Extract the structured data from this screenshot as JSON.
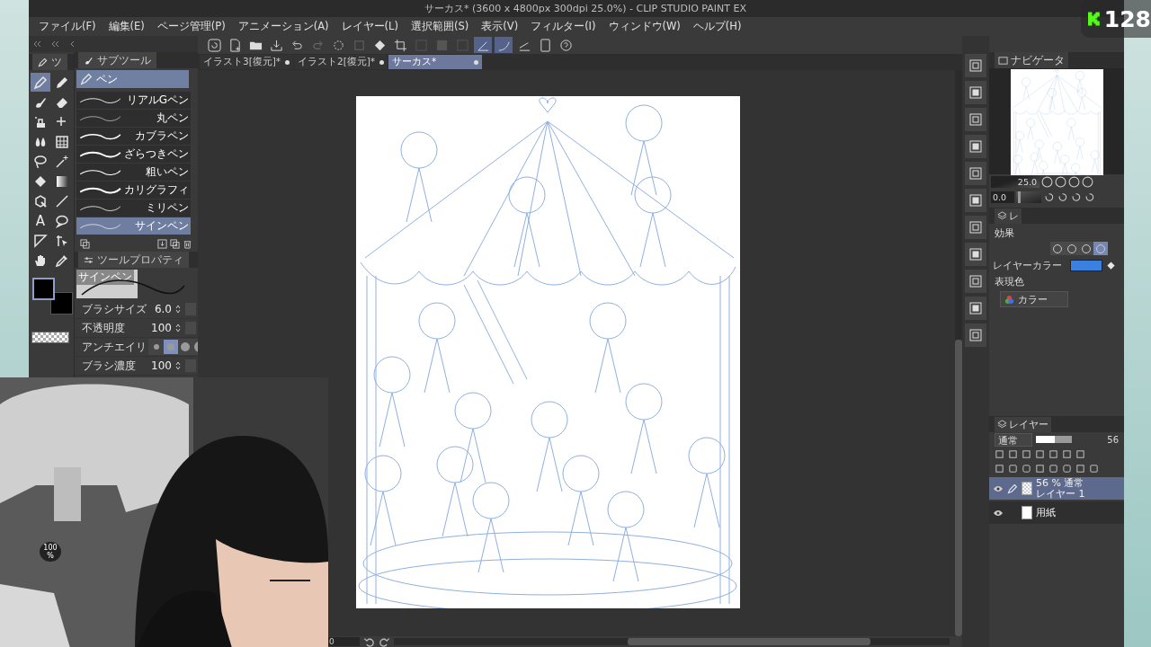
{
  "window": {
    "title": "サーカス* (3600 x 4800px 300dpi 25.0%) - CLIP STUDIO PAINT EX"
  },
  "menu": [
    "ファイル(F)",
    "編集(E)",
    "ページ管理(P)",
    "アニメーション(A)",
    "レイヤー(L)",
    "選択範囲(S)",
    "表示(V)",
    "フィルター(I)",
    "ウィンドウ(W)",
    "ヘルプ(H)"
  ],
  "doc_tabs": [
    {
      "label": "イラスト3[復元]*",
      "selected": false
    },
    {
      "label": "イラスト2[復元]*",
      "selected": false
    },
    {
      "label": "サーカス*",
      "selected": true
    }
  ],
  "tool_palette": {
    "tab": "ツ",
    "tools": [
      {
        "selected": true
      },
      {
        "selected": false
      },
      {
        "selected": false
      },
      {
        "selected": false
      },
      {
        "selected": false
      },
      {
        "selected": false
      },
      {
        "selected": false
      },
      {
        "selected": false
      },
      {
        "selected": false
      },
      {
        "selected": false
      },
      {
        "selected": false
      },
      {
        "selected": false
      },
      {
        "selected": false
      },
      {
        "selected": false
      },
      {
        "glyph": "A",
        "selected": false
      },
      {
        "selected": false
      },
      {
        "selected": false
      },
      {
        "selected": false
      },
      {
        "selected": false
      },
      {
        "selected": false
      }
    ]
  },
  "colors": [
    {
      "color": "#000000"
    },
    {
      "color": "#000000"
    }
  ],
  "subtool": {
    "tab": "サブツール",
    "group": "ペン",
    "brushes": [
      {
        "name": "リアルGペン",
        "selected": false
      },
      {
        "name": "丸ペン",
        "selected": false
      },
      {
        "name": "カブラペン",
        "selected": false
      },
      {
        "name": "ざらつきペン",
        "selected": false
      },
      {
        "name": "粗いペン",
        "selected": false
      },
      {
        "name": "カリグラフィ",
        "selected": false
      },
      {
        "name": "ミリペン",
        "selected": false
      },
      {
        "name": "サインペン",
        "selected": true
      }
    ]
  },
  "tool_property": {
    "tab": "ツールプロパティ",
    "preview_label": "サインペン",
    "rows": [
      {
        "kind": "number",
        "label": "ブラシサイズ",
        "value": "6.0"
      },
      {
        "kind": "number",
        "label": "不透明度",
        "value": "100"
      },
      {
        "kind": "choice",
        "label": "アンチエイリ",
        "options": [
          {
            "selected": false
          },
          {
            "selected": true
          },
          {
            "selected": false
          },
          {
            "selected": false
          }
        ]
      },
      {
        "kind": "number",
        "label": "ブラシ濃度",
        "value": "100"
      }
    ]
  },
  "color_panel": {
    "opacity": "100 %"
  },
  "canvas_status": {
    "rotation": "0"
  },
  "navigator": {
    "tab": "ナビゲータ",
    "zoom": "25.0",
    "rotation": "0.0",
    "rotation_slider": {
      "level": 0.1
    }
  },
  "layer_property": {
    "tab": "レ",
    "effect_label": "効果",
    "effects": [
      {
        "selected": false
      },
      {
        "selected": false
      },
      {
        "selected": false
      },
      {
        "selected": true
      }
    ],
    "layer_color_label": "レイヤーカラー",
    "layer_color": {
      "color": "#3b82e0"
    },
    "expression_label": "表現色",
    "expression": "カラー"
  },
  "layers_panel": {
    "tab": "レイヤー",
    "blend": "通常",
    "opacity_slider": {
      "level": 0.56
    },
    "opacity": "56",
    "layers": [
      {
        "info": "56 % 通常",
        "name": "レイヤー 1",
        "visible": true,
        "selected": true
      },
      {
        "name": "用紙",
        "visible": true,
        "selected": false
      }
    ]
  },
  "stream_badge": {
    "count": "128"
  }
}
